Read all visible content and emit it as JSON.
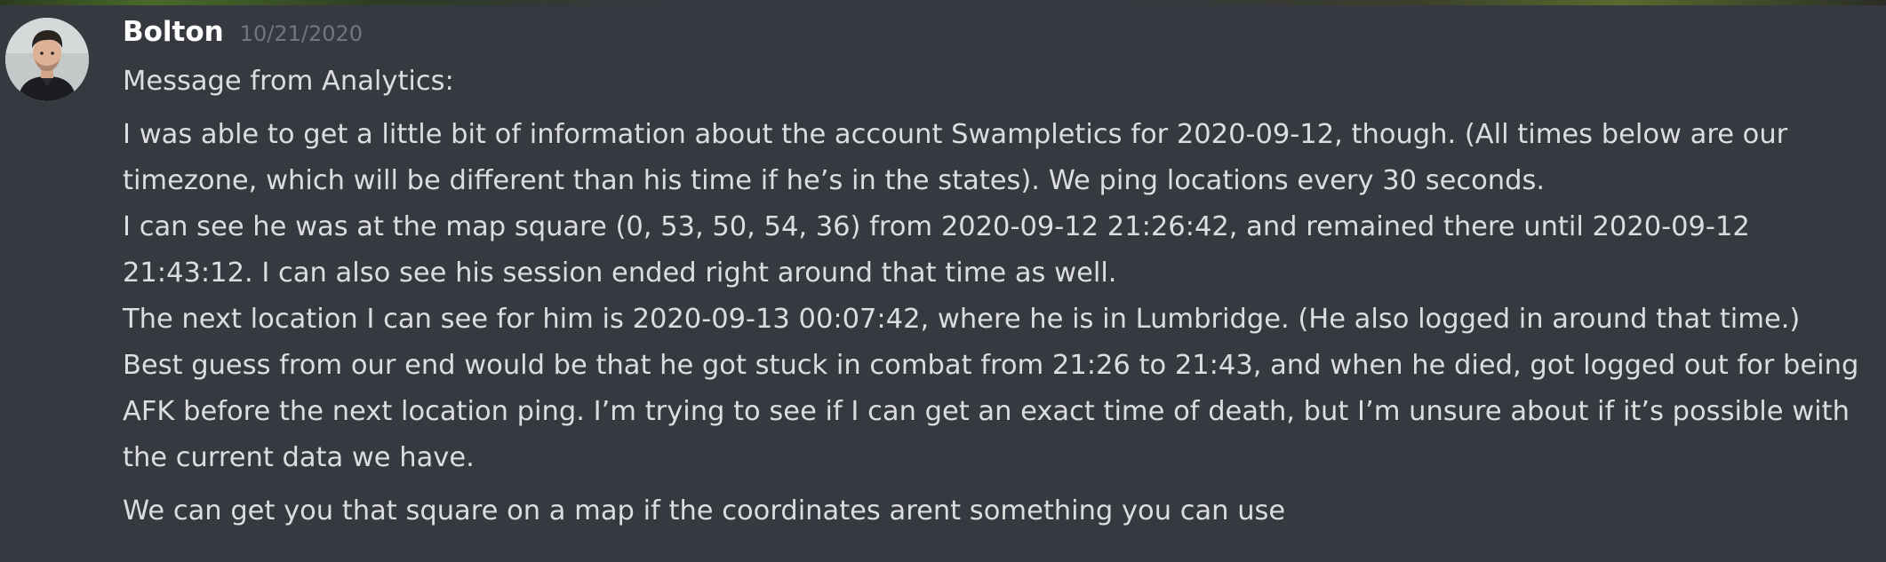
{
  "message": {
    "author": "Bolton",
    "timestamp": "10/21/2020",
    "lines": [
      "Message from Analytics:",
      "I was able to get a little bit of information about the account Swampletics for 2020-09-12, though.  (All times below are our",
      "timezone, which will be different than his time if he’s in the states). We ping locations every 30 seconds.",
      "I can see he was at the map square (0, 53, 50, 54, 36) from 2020-09-12 21:26:42, and remained there until 2020-09-12",
      "21:43:12. I can also see his session ended right around that time as well.",
      "The next location I can see for him is 2020-09-13 00:07:42, where he is in Lumbridge. (He also logged in around that time.)",
      "Best guess from our end would be that he got stuck in combat from 21:26 to 21:43, and when he died, got logged out for being",
      "AFK before the next location ping. I’m trying to see if I can get an exact time of death, but I’m unsure about if it’s possible with",
      "the current data we have."
    ],
    "follow_up": "We can get you that square on a map if the coordinates arent something you can use",
    "avatar_icon": "user-avatar-photo"
  },
  "colors": {
    "background": "#36393f",
    "username": "#ffffff",
    "timestamp": "#72767d",
    "text": "#dcddde"
  }
}
